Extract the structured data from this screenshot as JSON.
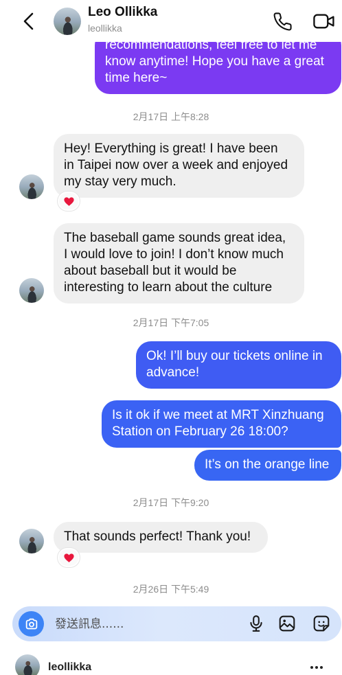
{
  "header": {
    "name": "Leo Ollikka",
    "username": "leollikka",
    "back_icon": "chevron-left-icon",
    "call_icon": "phone-icon",
    "video_icon": "video-camera-icon"
  },
  "messages": [
    {
      "lines": [
        "recommendations, feel free to let me",
        "know anytime! Hope you have a great",
        "time here~"
      ]
    },
    {
      "lines": [
        "Hey! Everything is great! I have been",
        "in Taipei now over a week and enjoyed",
        "my stay very much."
      ],
      "reaction_icon": "red-heart-icon"
    },
    {
      "lines": [
        "The baseball game sounds great idea,",
        "I would love to join! I don’t know much",
        "about baseball but it would be",
        "interesting to learn about the culture"
      ]
    },
    {
      "lines": [
        "Ok! I’ll buy our tickets online in",
        "advance!"
      ]
    },
    {
      "lines": [
        "Is it ok if we meet at MRT Xinzhuang",
        "Station on February 26 18:00?"
      ]
    },
    {
      "lines": [
        "It’s on the orange line"
      ]
    },
    {
      "lines": [
        "That sounds perfect! Thank you!"
      ],
      "reaction_icon": "red-heart-icon"
    }
  ],
  "timestamps": [
    "2月17日 上午8:28",
    "2月17日 下午7:05",
    "2月17日 下午9:20",
    "2月26日 下午5:49"
  ],
  "composer": {
    "placeholder": "發送訊息......",
    "camera_icon": "camera-icon",
    "mic_icon": "microphone-icon",
    "gallery_icon": "image-icon",
    "sticker_icon": "sticker-icon"
  },
  "footer": {
    "username": "leollikka",
    "more_icon": "more-horizontal-icon"
  },
  "colors": {
    "outgoing_purple": "#7b3af2",
    "outgoing_blue_1": "#3f5cf3",
    "outgoing_blue_2": "#3b62f4",
    "outgoing_blue_3": "#3866f3",
    "incoming_bubble": "#efefef",
    "camera_button": "#3d84f6",
    "reaction_heart": "#e8173d"
  }
}
